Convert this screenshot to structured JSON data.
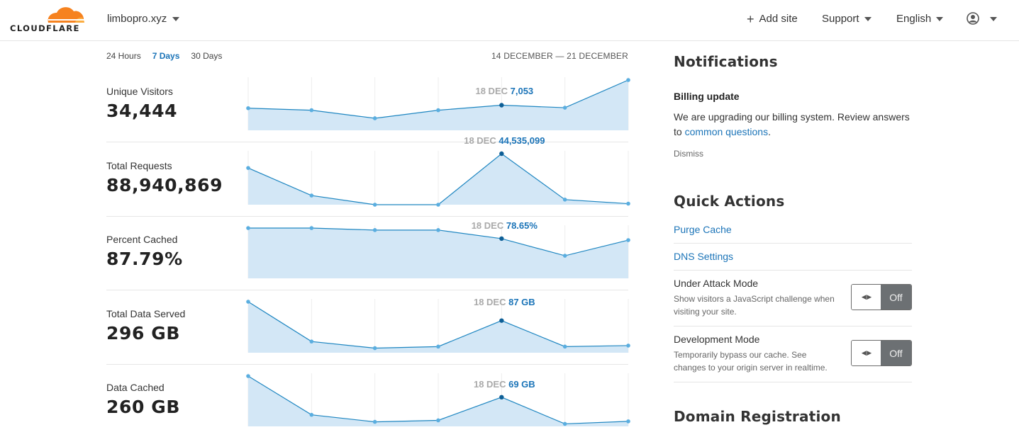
{
  "header": {
    "logo_text": "CLOUDFLARE",
    "site": "limbopro.xyz",
    "add_site": "Add site",
    "support": "Support",
    "language": "English"
  },
  "analytics": {
    "tabs": [
      {
        "label": "24 Hours",
        "active": false
      },
      {
        "label": "7 Days",
        "active": true
      },
      {
        "label": "30 Days",
        "active": false
      }
    ],
    "date_range": "14 DECEMBER — 21 DECEMBER",
    "metrics": [
      {
        "label": "Unique Visitors",
        "value": "34,444",
        "tooltip_date": "18 DEC",
        "tooltip_value": "7,053"
      },
      {
        "label": "Total Requests",
        "value": "88,940,869",
        "tooltip_date": "18 DEC",
        "tooltip_value": "44,535,099"
      },
      {
        "label": "Percent Cached",
        "value": "87.79%",
        "tooltip_date": "18 DEC",
        "tooltip_value": "78.65%"
      },
      {
        "label": "Total Data Served",
        "value": "296 GB",
        "tooltip_date": "18 DEC",
        "tooltip_value": "87 GB"
      },
      {
        "label": "Data Cached",
        "value": "260 GB",
        "tooltip_date": "18 DEC",
        "tooltip_value": "69 GB"
      }
    ]
  },
  "chart_data": [
    {
      "type": "area",
      "title": "Unique Visitors",
      "values": [
        0.44,
        0.4,
        0.24,
        0.4,
        0.5,
        0.45,
        1.0
      ],
      "highlight_index": 4
    },
    {
      "type": "area",
      "title": "Total Requests",
      "values": [
        0.72,
        0.18,
        0.0,
        0.0,
        1.0,
        0.1,
        0.02
      ],
      "highlight_index": 4
    },
    {
      "type": "area",
      "title": "Percent Cached",
      "values": [
        1.0,
        1.0,
        0.96,
        0.96,
        0.79,
        0.45,
        0.76
      ],
      "highlight_index": 4
    },
    {
      "type": "area",
      "title": "Total Data Served",
      "values": [
        1.0,
        0.22,
        0.09,
        0.12,
        0.63,
        0.12,
        0.14
      ],
      "highlight_index": 4
    },
    {
      "type": "area",
      "title": "Data Cached",
      "values": [
        1.0,
        0.23,
        0.09,
        0.12,
        0.58,
        0.05,
        0.1
      ],
      "highlight_index": 4
    }
  ],
  "notifications": {
    "title": "Notifications",
    "item_title": "Billing update",
    "body": "We are upgrading our billing system. Review answers to",
    "link": "common questions",
    "suffix": ".",
    "dismiss": "Dismiss"
  },
  "quick_actions": {
    "title": "Quick Actions",
    "purge_cache": "Purge Cache",
    "dns_settings": "DNS Settings",
    "under_attack": {
      "title": "Under Attack Mode",
      "desc": "Show visitors a JavaScript challenge when visiting your site.",
      "state": "Off"
    },
    "dev_mode": {
      "title": "Development Mode",
      "desc": "Temporarily bypass our cache. See changes to your origin server in realtime.",
      "state": "Off"
    }
  },
  "domain_registration": {
    "title": "Domain Registration"
  },
  "colors": {
    "accent": "#1b74b8",
    "chart_line": "#1e86c1",
    "chart_fill": "#d3e7f6",
    "chart_dot": "#5aaee0"
  },
  "icons": [
    "cloudflare-logo",
    "caret-down-icon",
    "plus-icon",
    "user-icon",
    "toggle-arrows-icon"
  ]
}
